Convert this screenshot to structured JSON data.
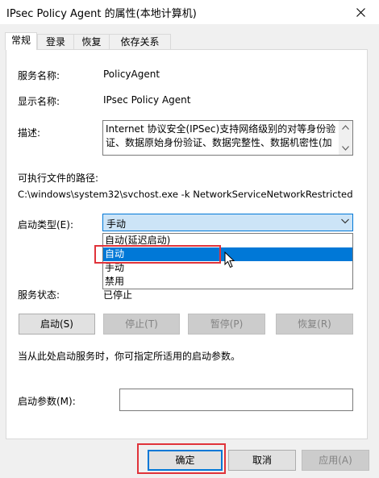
{
  "window": {
    "title": "IPsec Policy Agent 的属性(本地计算机)"
  },
  "tabs": [
    {
      "label": "常规"
    },
    {
      "label": "登录"
    },
    {
      "label": "恢复"
    },
    {
      "label": "依存关系"
    }
  ],
  "general": {
    "service_name_label": "服务名称:",
    "service_name_value": "PolicyAgent",
    "display_name_label": "显示名称:",
    "display_name_value": "IPsec Policy Agent",
    "description_label": "描述:",
    "description_value": "Internet 协议安全(IPSec)支持网络级别的对等身份验证、数据原始身份验证、数据完整性、数据机密性(加",
    "exe_path_label": "可执行文件的路径:",
    "exe_path_value": "C:\\windows\\system32\\svchost.exe -k NetworkServiceNetworkRestricted",
    "startup_type_label": "启动类型(E):",
    "startup_type_value": "手动",
    "startup_options": [
      {
        "label": "自动(延迟启动)"
      },
      {
        "label": "自动"
      },
      {
        "label": "手动"
      },
      {
        "label": "禁用"
      }
    ],
    "service_status_label": "服务状态:",
    "service_status_value": "已停止",
    "start_button": "启动(S)",
    "stop_button": "停止(T)",
    "pause_button": "暂停(P)",
    "resume_button": "恢复(R)",
    "hint_text": "当从此处启动服务时，你可指定所适用的启动参数。",
    "start_params_label": "启动参数(M):",
    "start_params_value": ""
  },
  "footer": {
    "ok_button": "确定",
    "cancel_button": "取消",
    "apply_button": "应用(A)"
  },
  "colors": {
    "highlight_border": "#e0333a",
    "selection": "#0078d7",
    "select_bg": "#cce4f7"
  }
}
